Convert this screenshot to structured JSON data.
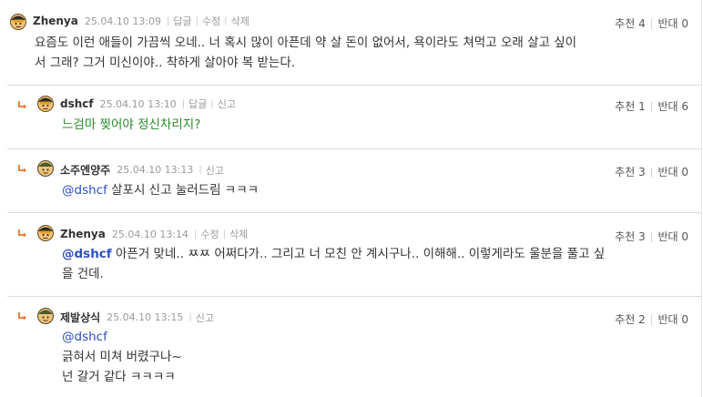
{
  "comments": [
    {
      "nick": "Zhenya",
      "date": "25.04.10 13:09",
      "actions": [
        "답글",
        "수정",
        "삭제"
      ],
      "up_label": "추천",
      "up": "4",
      "down_label": "반대",
      "down": "0",
      "text_line1": "요즘도 이런 애들이 가끔씩 오네.. 너 혹시 많이 아픈데 약 살 돈이 없어서, 욕이라도 쳐먹고 오래 살고 싶이",
      "text_line2": "서 그래? 그거 미신이야.. 착하게 살아야 복 받는다."
    },
    {
      "nick": "dshcf",
      "date": "25.04.10 13:10",
      "actions": [
        "답글",
        "신고"
      ],
      "up_label": "추천",
      "up": "1",
      "down_label": "반대",
      "down": "6",
      "text_line1": "느검마 찢어야 정신차리지?"
    },
    {
      "nick": "소주엔양주",
      "date": "25.04.10 13:13",
      "actions": [
        "신고"
      ],
      "up_label": "추천",
      "up": "3",
      "down_label": "반대",
      "down": "0",
      "mention": "@dshcf",
      "text_line1": " 살포시 신고 눌러드림 ㅋㅋㅋ"
    },
    {
      "nick": "Zhenya",
      "date": "25.04.10 13:14",
      "actions": [
        "수정",
        "삭제"
      ],
      "up_label": "추천",
      "up": "3",
      "down_label": "반대",
      "down": "0",
      "mention": "@dshcf",
      "text_line1": " 아픈거 맞네.. ㅉㅉ 어쩌다가.. 그리고 너 모친 안 계시구나.. 이해해.. 이렇게라도 울분을 풀고 싶",
      "text_line2": "을 건데."
    },
    {
      "nick": "제발상식",
      "date": "25.04.10 13:15",
      "actions": [
        "신고"
      ],
      "up_label": "추천",
      "up": "2",
      "down_label": "반대",
      "down": "0",
      "mention": "@dshcf",
      "text_line2": "긁혀서 미쳐 버렸구나~",
      "text_line3": "넌 갈거 같다 ㅋㅋㅋㅋ"
    }
  ]
}
